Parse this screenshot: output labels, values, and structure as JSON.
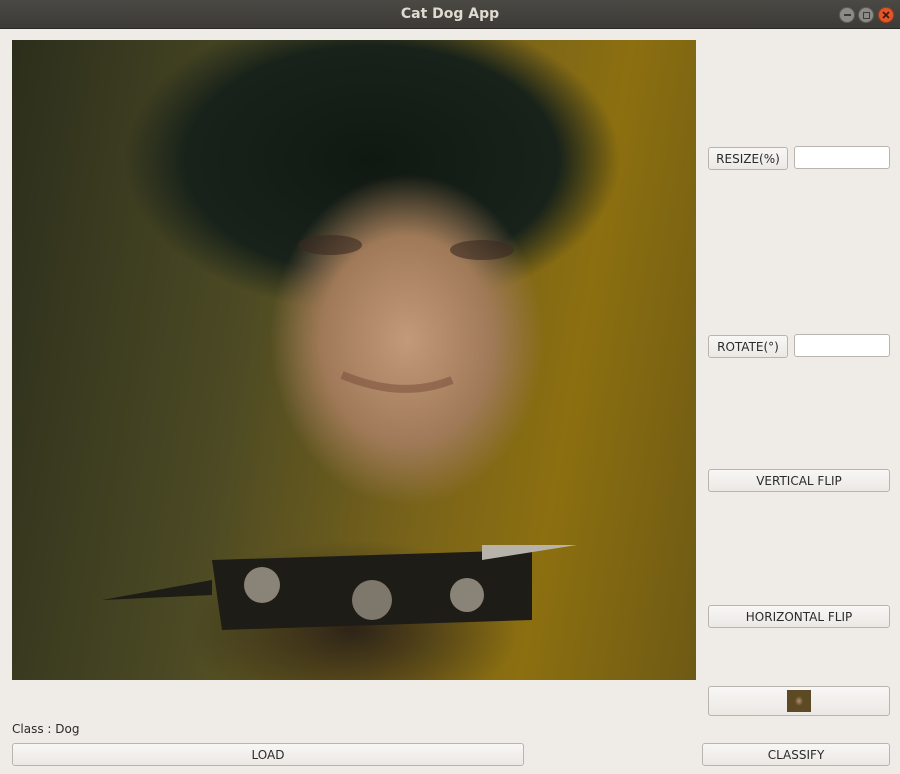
{
  "window": {
    "title": "Cat Dog App"
  },
  "controls": {
    "resize_label": "RESIZE(%)",
    "resize_value": "",
    "rotate_label": "ROTATE(°)",
    "rotate_value": "",
    "vertical_flip_label": "VERTICAL FLIP",
    "horizontal_flip_label": "HORIZONTAL FLIP"
  },
  "result": {
    "prefix": "Class : ",
    "value": "Dog"
  },
  "actions": {
    "load_label": "LOAD",
    "classify_label": "CLASSIFY"
  }
}
